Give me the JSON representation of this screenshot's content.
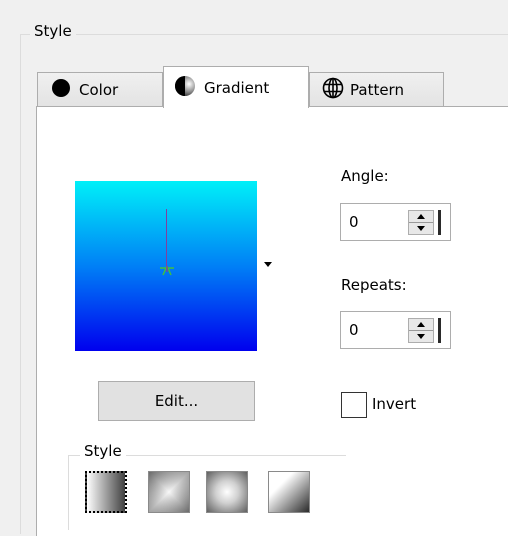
{
  "style_group": {
    "title": "Style"
  },
  "tabs": [
    {
      "label": "Color",
      "icon": "filled-circle-icon",
      "active": false
    },
    {
      "label": "Gradient",
      "icon": "shaded-sphere-icon",
      "active": true
    },
    {
      "label": "Pattern",
      "icon": "globe-grid-icon",
      "active": false
    }
  ],
  "gradient": {
    "colors": {
      "top": "#00f0f8",
      "bottom": "#0000ee"
    },
    "angle_label": "Angle:",
    "angle_value": "0",
    "repeats_label": "Repeats:",
    "repeats_value": "0",
    "edit_button": "Edit...",
    "invert_label": "Invert",
    "invert_checked": false
  },
  "inner_style_group": {
    "title": "Style",
    "options": [
      {
        "name": "linear",
        "icon": "linear-gradient-icon",
        "selected": true
      },
      {
        "name": "rectangular",
        "icon": "rectangular-gradient-icon",
        "selected": false
      },
      {
        "name": "radial",
        "icon": "radial-gradient-icon",
        "selected": false
      },
      {
        "name": "corner",
        "icon": "corner-gradient-icon",
        "selected": false
      }
    ]
  }
}
